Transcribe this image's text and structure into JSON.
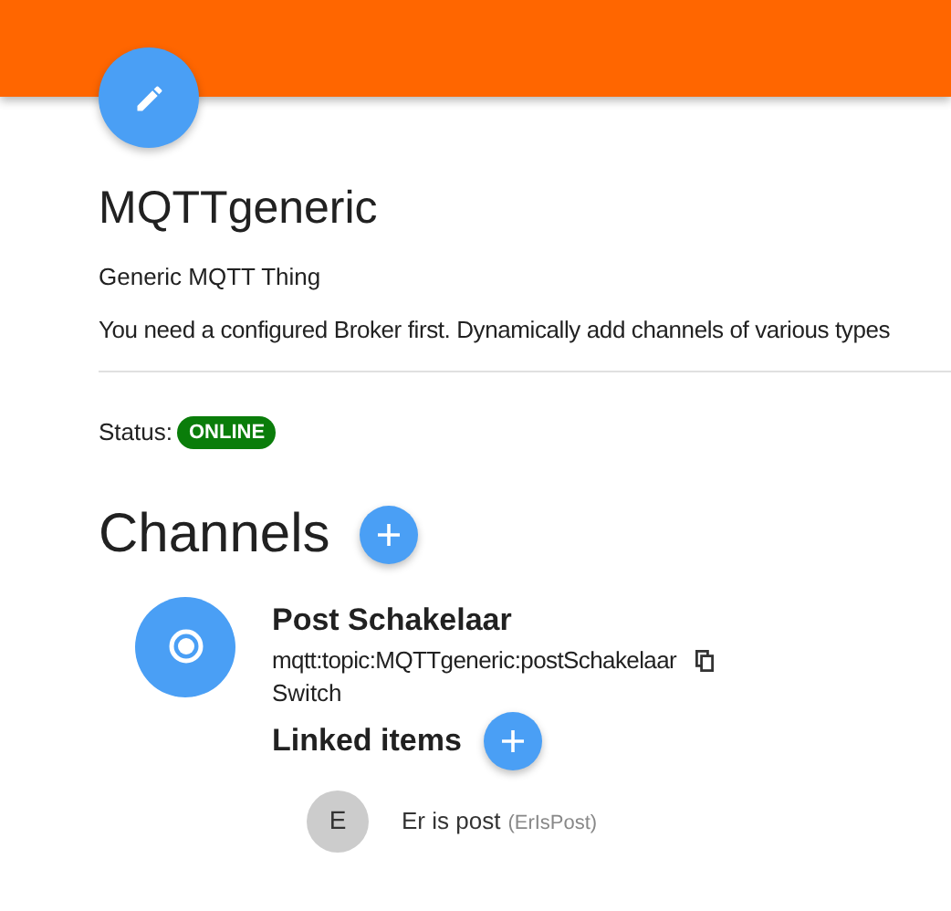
{
  "thing": {
    "title": "MQTTgeneric",
    "subtitle": "Generic MQTT Thing",
    "description": "You need a configured Broker first. Dynamically add channels of various types"
  },
  "status": {
    "label": "Status:",
    "value": "ONLINE",
    "kind": "online"
  },
  "channels_section": {
    "title": "Channels"
  },
  "channels": [
    {
      "name": "Post Schakelaar",
      "uid": "mqtt:topic:MQTTgeneric:postSchakelaar",
      "type": "Switch",
      "linked_items_title": "Linked items",
      "linked_items": [
        {
          "initial": "E",
          "label": "Er is post",
          "name": "(ErIsPost)"
        }
      ]
    }
  ]
}
